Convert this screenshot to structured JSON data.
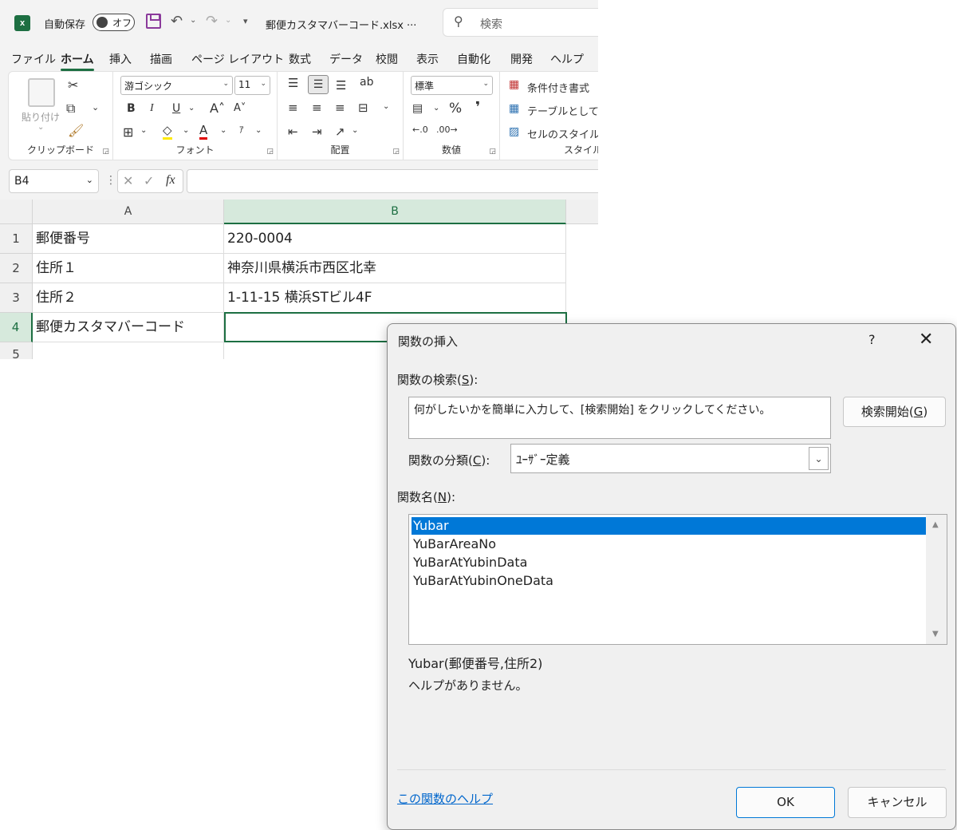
{
  "excel": {
    "titlebar": {
      "autosave_label": "自動保存",
      "autosave_state": "オフ",
      "filename": "郵便カスタマバーコード.xlsx",
      "filename_more": "···",
      "search_placeholder": "検索"
    },
    "menu_tabs": [
      "ファイル",
      "ホーム",
      "挿入",
      "描画",
      "ページ レイアウト",
      "数式",
      "データ",
      "校閲",
      "表示",
      "自動化",
      "開発",
      "ヘルプ"
    ],
    "active_tab": "ホーム",
    "ribbon": {
      "clipboard": {
        "paste_label": "貼り付け",
        "group_label": "クリップボード"
      },
      "font": {
        "font_name": "游ゴシック",
        "font_size": "11",
        "group_label": "フォント",
        "bold": "B",
        "italic": "I",
        "underline": "U"
      },
      "alignment": {
        "group_label": "配置"
      },
      "number": {
        "format": "標準",
        "group_label": "数値",
        "percent": "%",
        "comma": "❜"
      },
      "styles": {
        "conditional": "条件付き書式",
        "table": "テーブルとして書式",
        "cell_style": "セルのスタイル",
        "group_label": "スタイル"
      }
    },
    "formula_bar": {
      "name_box": "B4",
      "fx": "fx"
    },
    "columns": [
      "A",
      "B"
    ],
    "rows": [
      {
        "num": "1",
        "a": "郵便番号",
        "b": "220-0004"
      },
      {
        "num": "2",
        "a": "住所１",
        "b": "神奈川県横浜市西区北幸"
      },
      {
        "num": "3",
        "a": "住所２",
        "b": "1-11-15 横浜STビル4F"
      },
      {
        "num": "4",
        "a": "郵便カスタマバーコード",
        "b": ""
      },
      {
        "num": "5",
        "a": "",
        "b": ""
      }
    ]
  },
  "dialog": {
    "title": "関数の挿入",
    "help": "?",
    "search_label": "関数の検索(",
    "search_key": "S",
    "search_label_end": "):",
    "search_text": "何がしたいかを簡単に入力して、[検索開始] をクリックしてください。",
    "search_button": "検索開始(",
    "search_button_key": "G",
    "search_button_end": ")",
    "category_label": "関数の分類(",
    "category_key": "C",
    "category_label_end": "):",
    "category_value": "ﾕｰｻﾞｰ定義",
    "name_label": "関数名(",
    "name_key": "N",
    "name_label_end": "):",
    "functions": [
      "Yubar",
      "YuBarAreaNo",
      "YuBarAtYubinData",
      "YuBarAtYubinOneData"
    ],
    "selected_function": "Yubar",
    "signature": "Yubar(郵便番号,住所2)",
    "description": "ヘルプがありません。",
    "help_link": "この関数のヘルプ",
    "ok": "OK",
    "cancel": "キャンセル"
  },
  "colors": {
    "excel_green": "#1d6f42",
    "selection_blue": "#0078d7",
    "link_blue": "#0066cc"
  }
}
